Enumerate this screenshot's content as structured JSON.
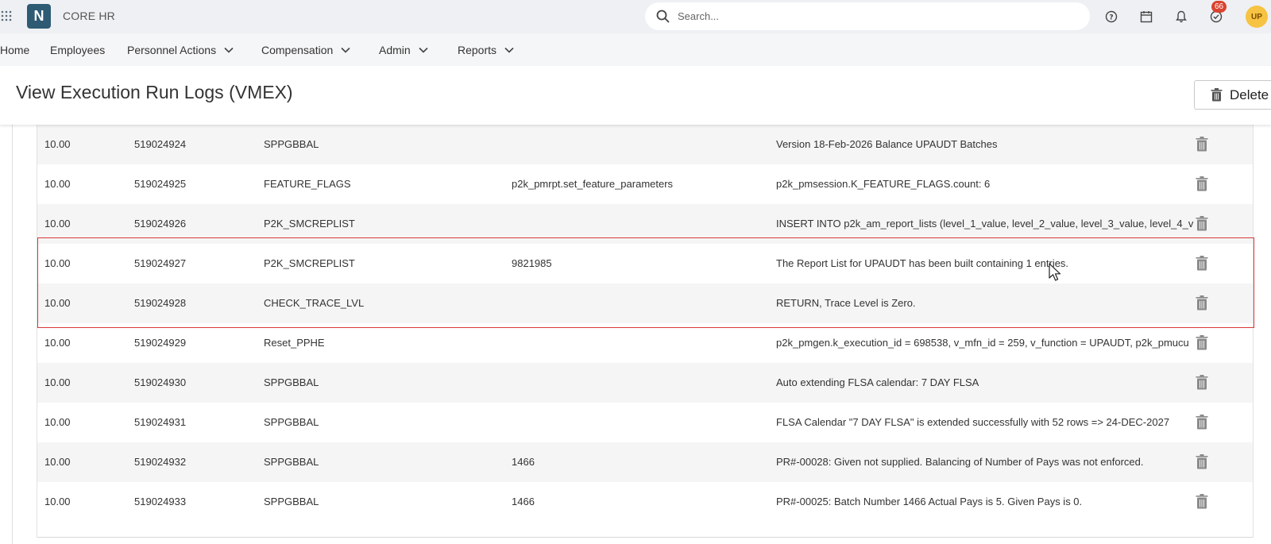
{
  "app": {
    "logo_letter": "N",
    "name": "CORE HR"
  },
  "search": {
    "placeholder": "Search..."
  },
  "topbar": {
    "notification_count": "66",
    "avatar_initials": "UP"
  },
  "nav": {
    "items": [
      {
        "label": "Home"
      },
      {
        "label": "Employees"
      },
      {
        "label": "Personnel Actions"
      },
      {
        "label": "Compensation"
      },
      {
        "label": "Admin"
      },
      {
        "label": "Reports"
      }
    ]
  },
  "header": {
    "title": "View Execution Run Logs (VMEX)",
    "delete_label": "Delete"
  },
  "table": {
    "rows": [
      {
        "c1": "10.00",
        "c2": "519024924",
        "c3": "SPPGBBAL",
        "c4": "",
        "c5": "Version 18-Feb-2026 Balance UPAUDT Batches"
      },
      {
        "c1": "10.00",
        "c2": "519024925",
        "c3": "FEATURE_FLAGS",
        "c4": "p2k_pmrpt.set_feature_parameters",
        "c5": "p2k_pmsession.K_FEATURE_FLAGS.count: 6"
      },
      {
        "c1": "10.00",
        "c2": "519024926",
        "c3": "P2K_SMCREPLIST",
        "c4": "",
        "c5": "INSERT INTO p2k_am_report_lists (level_1_value, level_2_value, level_3_value, level_4_v"
      },
      {
        "c1": "10.00",
        "c2": "519024927",
        "c3": "P2K_SMCREPLIST",
        "c4": "9821985",
        "c5": "The Report List for UPAUDT has been built containing 1 entries."
      },
      {
        "c1": "10.00",
        "c2": "519024928",
        "c3": "CHECK_TRACE_LVL",
        "c4": "",
        "c5": "RETURN, Trace Level is Zero."
      },
      {
        "c1": "10.00",
        "c2": "519024929",
        "c3": "Reset_PPHE",
        "c4": "",
        "c5": "p2k_pmgen.k_execution_id = 698538, v_mfn_id = 259, v_function = UPAUDT, p2k_pmucu"
      },
      {
        "c1": "10.00",
        "c2": "519024930",
        "c3": "SPPGBBAL",
        "c4": "",
        "c5": "Auto extending FLSA calendar: 7 DAY FLSA"
      },
      {
        "c1": "10.00",
        "c2": "519024931",
        "c3": "SPPGBBAL",
        "c4": "",
        "c5": "FLSA Calendar \"7 DAY FLSA\" is extended successfully with 52 rows => 24-DEC-2027"
      },
      {
        "c1": "10.00",
        "c2": "519024932",
        "c3": "SPPGBBAL",
        "c4": "1466",
        "c5": "PR#-00028: Given not supplied. Balancing of Number of Pays was not enforced."
      },
      {
        "c1": "10.00",
        "c2": "519024933",
        "c3": "SPPGBBAL",
        "c4": "1466",
        "c5": "PR#-00025: Batch Number 1466 Actual Pays is 5. Given Pays is 0."
      }
    ]
  },
  "colors": {
    "brand": "#2f5a74",
    "highlight": "#d93a3a",
    "badge": "#d9432f",
    "avatar": "#f6c343"
  }
}
